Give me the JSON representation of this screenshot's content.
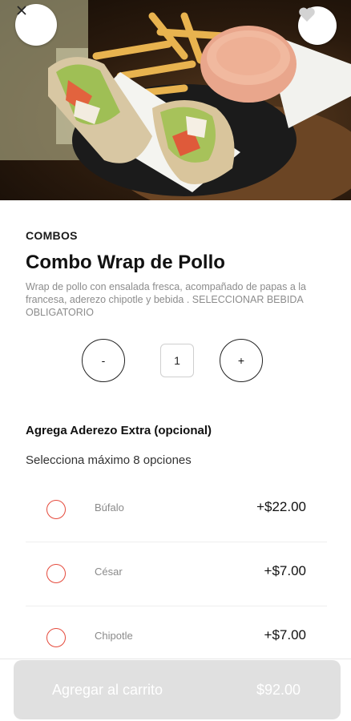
{
  "product": {
    "category": "COMBOS",
    "name": "Combo Wrap de Pollo",
    "description": "Wrap de pollo con ensalada fresca, acompañado de papas a la francesa, aderezo chipotle y bebida . SELECCIONAR BEBIDA OBLIGATORIO"
  },
  "quantity": {
    "minus_label": "-",
    "value": "1",
    "plus_label": "+"
  },
  "extras": {
    "title": "Agrega Aderezo Extra (opcional)",
    "subtitle": "Selecciona máximo 8 opciones",
    "options": [
      {
        "label": "Búfalo",
        "price": "+$22.00",
        "selected": false
      },
      {
        "label": "César",
        "price": "+$7.00",
        "selected": false
      },
      {
        "label": "Chipotle",
        "price": "+$7.00",
        "selected": false
      }
    ]
  },
  "cart": {
    "button_label": "Agregar al carrito",
    "total": "$92.00",
    "enabled": false
  },
  "icons": {
    "close": "close-icon",
    "favorite": "heart-icon"
  },
  "colors": {
    "accent": "#e5493b",
    "button_disabled": "#e0e0e0"
  }
}
